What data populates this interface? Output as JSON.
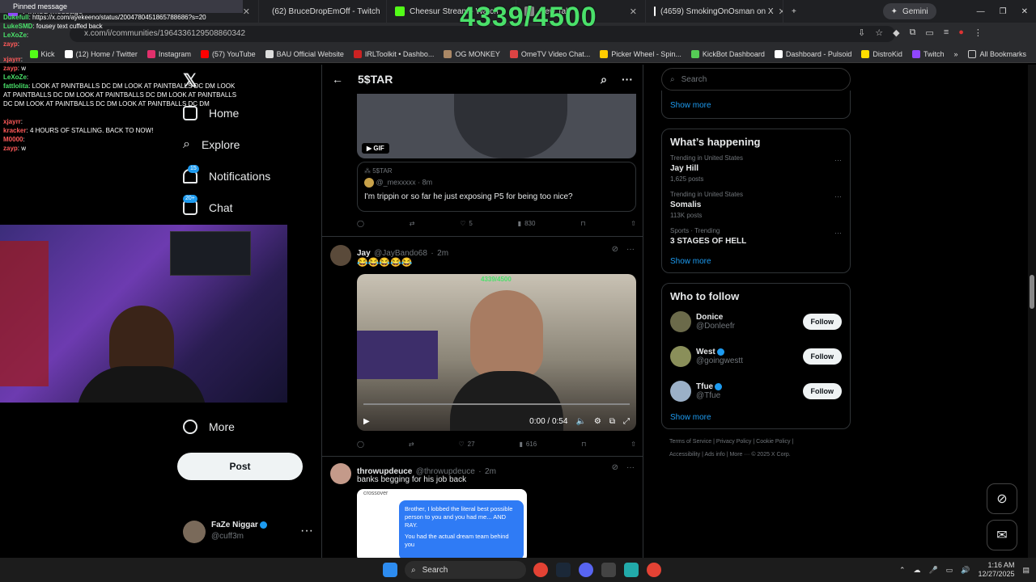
{
  "counter": "4339/4500",
  "tabs": [
    {
      "label": "Pinned message",
      "color": "#9146ff"
    },
    {
      "label": "(62) BruceDropEmOff - Twitch",
      "color": "#9146ff"
    },
    {
      "label": "Cheesur Stream - Watch",
      "color": "#53fc18"
    },
    {
      "label": "New Tab",
      "color": "#888888"
    },
    {
      "label": "(4659) SmokingOnOsman on X",
      "color": "#e7e9ea"
    }
  ],
  "gemini": "Gemini",
  "url": "x.com/i/communities/1964336129508860342",
  "bookmarks": [
    "Kick",
    "(12) Home / Twitter",
    "Instagram",
    "(57) YouTube",
    "BAU Official Website",
    "IRLToolkit • Dashbo...",
    "OG MONKEY",
    "OmeTV Video Chat...",
    "Picker Wheel - Spin...",
    "KickBot Dashboard",
    "Dashboard - Pulsoid",
    "DistroKid",
    "Twitch"
  ],
  "all_bookmarks": "All Bookmarks",
  "chat": {
    "pinned_title": "Pinned message",
    "pinned_user": "Dukefull",
    "pinned_text": "https://x.com/ayekeeno/status/2004780451865788686?s=20",
    "pinned_user2": "LukeSMD",
    "pinned_text2": "fousey text cuffed back",
    "messages": [
      {
        "user": "LeXoZe",
        "text": "",
        "color": "#4ae06a"
      },
      {
        "user": "zayp",
        "text": "",
        "color": "#ff5a5a"
      },
      {
        "user": "xjayrr",
        "text": "",
        "color": "#ff5a5a"
      },
      {
        "user": "zayp",
        "text": "w",
        "color": "#ff5a5a"
      },
      {
        "user": "LeXoZe",
        "text": "",
        "color": "#4ae06a"
      },
      {
        "user": "fattlolita",
        "text": "LOOK AT PAINTBALLS DC DM  LOOK AT PAINTBALLS DC DM  LOOK AT PAINTBALLS DC DM  LOOK AT PAINTBALLS DC DM  LOOK AT PAINTBALLS DC DM  LOOK AT PAINTBALLS DC DM  LOOK AT PAINTBALLS DC DM",
        "color": "#4ae06a"
      },
      {
        "user": "xjayrr",
        "text": "",
        "color": "#ff5a5a"
      },
      {
        "user": "kracker",
        "text": "4 HOURS OF STALLING. BACK TO NOW!",
        "color": "#ff5a5a"
      },
      {
        "user": "M0000",
        "text": "",
        "color": "#ff5a5a"
      },
      {
        "user": "zayp",
        "text": "w",
        "color": "#ff5a5a"
      }
    ]
  },
  "nav": {
    "explore": "Explore",
    "notifications": "Notifications",
    "notif_badge": "15",
    "chat": "Chat",
    "chat_badge": "20+",
    "home": "Home",
    "more": "More",
    "post": "Post"
  },
  "account": {
    "name": "FaZe Niggar",
    "handle": "@cuff3m"
  },
  "header": {
    "title": "5$TAR"
  },
  "tweet1": {
    "gif": "GIF",
    "community": "5$TAR",
    "handle": "@_mexxxxx",
    "time": "8m",
    "text": "I'm trippin or so far he just exposing P5 for being too nice?",
    "likes": "5",
    "views": "830"
  },
  "tweet2": {
    "name": "Jay",
    "handle": "@JayBando68",
    "time": "2m",
    "text": "😂😂😂😂😂",
    "video_time": "0:00 / 0:54",
    "likes": "27",
    "views": "616",
    "overlay": "4339/4500"
  },
  "tweet3": {
    "name": "throwupdeuce",
    "handle": "@throwupdeuce",
    "time": "2m",
    "text": "banks begging for his job back",
    "img_line1": "crossover",
    "img_text": "Brother, I lobbed the literal best possible person to you and you had me... AND RAY.",
    "img_text2": "You had the actual dream team behind you"
  },
  "right": {
    "search_placeholder": "Search",
    "show_more": "Show more",
    "happening_title": "What’s happening",
    "trends": [
      {
        "category": "Trending in United States",
        "title": "Jay Hill",
        "count": "1,625 posts"
      },
      {
        "category": "Trending in United States",
        "title": "Somalis",
        "count": "113K posts"
      },
      {
        "category": "Sports · Trending",
        "title": "3 STAGES OF HELL",
        "count": ""
      }
    ],
    "wtf_title": "Who to follow",
    "follow": "Follow",
    "people": [
      {
        "name": "Donice",
        "handle": "@Donleefr",
        "verified": false,
        "color": "#6b6a4a"
      },
      {
        "name": "West",
        "handle": "@goingwestt",
        "verified": true,
        "color": "#8a8f5a"
      },
      {
        "name": "Tfue",
        "handle": "@Tfue",
        "verified": true,
        "color": "#9bb0c7"
      }
    ],
    "footer": [
      "Terms of Service",
      "Privacy Policy",
      "Cookie Policy",
      "Accessibility",
      "Ads info",
      "More ···",
      "© 2025 X Corp."
    ]
  },
  "taskbar": {
    "search": "Search",
    "time": "1:16 AM",
    "date": "12/27/2025"
  }
}
